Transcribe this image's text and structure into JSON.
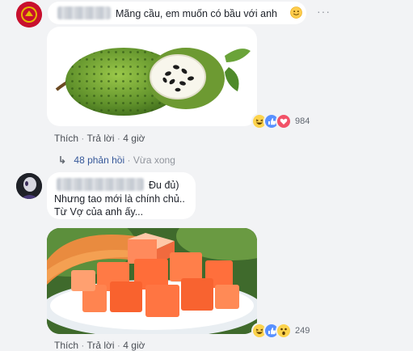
{
  "comment1": {
    "text": "Mãng cầu, em muốn có bầu với anh",
    "emoji": "slightly-smiling-face",
    "menu": "···",
    "actions": {
      "like": "Thích",
      "reply": "Trả lời",
      "time": "4 giờ",
      "sep": "·"
    },
    "reactions": {
      "icons": [
        "haha",
        "like",
        "love"
      ],
      "count": "984"
    },
    "replies": {
      "text": "48 phản hồi",
      "time": "Vừa xong",
      "sep": "·",
      "arrow": "↳"
    }
  },
  "comment2": {
    "name_suffix": "Đu đủ)",
    "line1": "Nhưng tao mới là chính chủ..",
    "line2": "Từ Vợ của anh ấy...",
    "actions": {
      "like": "Thích",
      "reply": "Trả lời",
      "time": "4 giờ",
      "sep": "·"
    },
    "reactions": {
      "icons": [
        "haha",
        "like",
        "wow"
      ],
      "count": "249"
    }
  },
  "colors": {
    "background": "#f2f3f5",
    "link_blue": "#365899",
    "like_blue": "#5890ff",
    "love_red": "#f25268",
    "haha_yellow": "#fcd34d"
  }
}
